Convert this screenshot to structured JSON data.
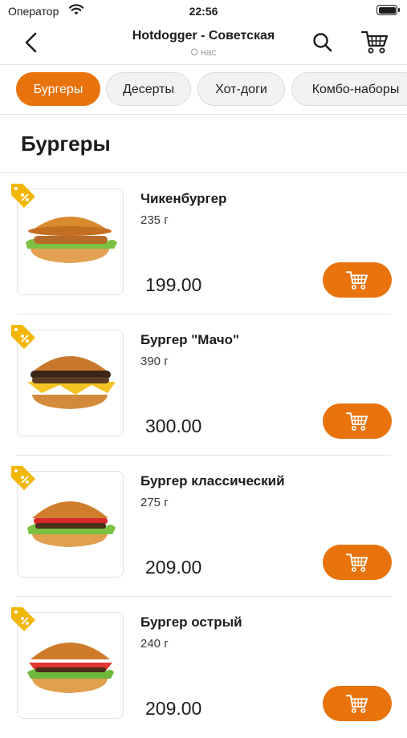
{
  "status_bar": {
    "carrier": "Оператор",
    "time": "22:56"
  },
  "header": {
    "title": "Hotdogger - Советская",
    "subtitle": "О нас"
  },
  "tabs": [
    {
      "label": "Бургеры",
      "active": true
    },
    {
      "label": "Десерты",
      "active": false
    },
    {
      "label": "Хот-доги",
      "active": false
    },
    {
      "label": "Комбо-наборы",
      "active": false
    }
  ],
  "section": {
    "title": "Бургеры"
  },
  "products": [
    {
      "name": "Чикенбургер",
      "weight": "235 г",
      "price": "199.00",
      "discount_icon": "discount-tag-icon"
    },
    {
      "name": "Бургер \"Мачо\"",
      "weight": "390 г",
      "price": "300.00",
      "discount_icon": "discount-tag-icon"
    },
    {
      "name": "Бургер классический",
      "weight": "275 г",
      "price": "209.00",
      "discount_icon": "discount-tag-icon"
    },
    {
      "name": "Бургер острый",
      "weight": "240 г",
      "price": "209.00",
      "discount_icon": "discount-tag-icon"
    }
  ],
  "colors": {
    "accent": "#e8730d",
    "tag": "#f2b705",
    "divider": "#e4e4e6"
  },
  "icons": [
    "back-chevron-icon",
    "search-icon",
    "cart-icon",
    "add-to-cart-icon",
    "discount-tag-icon",
    "wifi-icon",
    "battery-icon"
  ]
}
